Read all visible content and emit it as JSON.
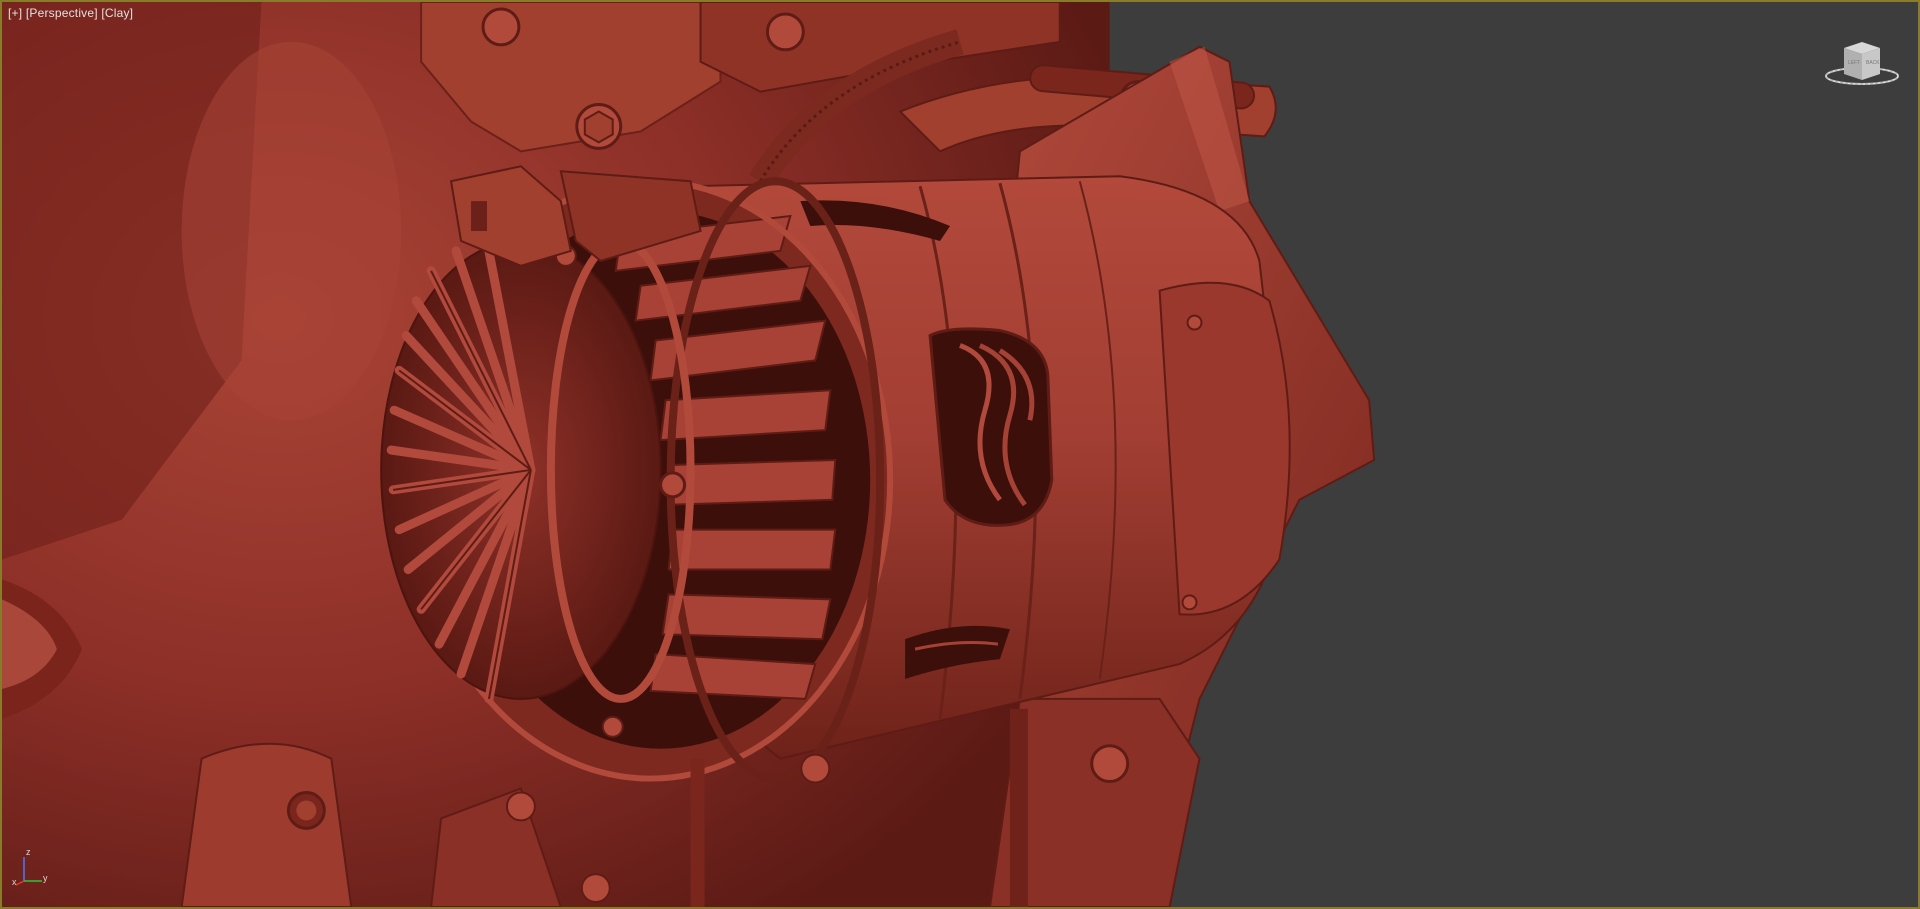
{
  "viewport": {
    "label_plus": "[+]",
    "label_view": "[Perspective]",
    "label_shading": "[Clay]",
    "border_color": "#8a7a2c",
    "background_color": "#3d3d3d",
    "clay_color": "#9c3a30"
  },
  "viewcube": {
    "left_face": "LEFT",
    "front_face": "BACK"
  },
  "axis_tripod": {
    "x_label": "x",
    "y_label": "y",
    "z_label": "z"
  }
}
